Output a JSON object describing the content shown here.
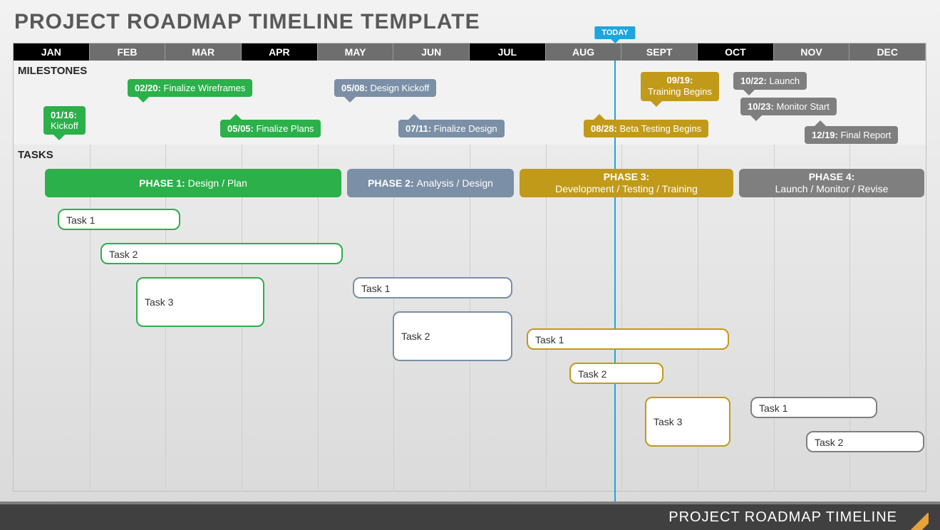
{
  "title": "PROJECT ROADMAP TIMELINE TEMPLATE",
  "footer": "PROJECT ROADMAP TIMELINE",
  "today_label": "TODAY",
  "months": [
    "JAN",
    "FEB",
    "MAR",
    "APR",
    "MAY",
    "JUN",
    "JUL",
    "AUG",
    "SEPT",
    "OCT",
    "NOV",
    "DEC"
  ],
  "section_labels": {
    "milestones": "MILESTONES",
    "tasks": "TASKS"
  },
  "milestones": [
    {
      "date": "01/16:",
      "text": "Kickoff"
    },
    {
      "date": "02/20:",
      "text": "Finalize Wireframes"
    },
    {
      "date": "05/05:",
      "text": "Finalize Plans"
    },
    {
      "date": "05/08:",
      "text": "Design Kickoff"
    },
    {
      "date": "07/11:",
      "text": "Finalize Design"
    },
    {
      "date": "08/28:",
      "text": "Beta Testing Begins"
    },
    {
      "date": "09/19:",
      "text": "Training Begins"
    },
    {
      "date": "10/22:",
      "text": "Launch"
    },
    {
      "date": "10/23:",
      "text": "Monitor Start"
    },
    {
      "date": "12/19:",
      "text": "Final Report"
    }
  ],
  "phases": [
    {
      "title": "PHASE 1:",
      "sub": "Design / Plan"
    },
    {
      "title": "PHASE 2:",
      "sub": "Analysis / Design"
    },
    {
      "title": "PHASE 3:",
      "sub": "Development / Testing / Training"
    },
    {
      "title": "PHASE 4:",
      "sub": "Launch / Monitor / Revise"
    }
  ],
  "tasks": {
    "p1": [
      "Task 1",
      "Task 2",
      "Task 3"
    ],
    "p2": [
      "Task 1",
      "Task 2"
    ],
    "p3": [
      "Task 1",
      "Task 2",
      "Task 3"
    ],
    "p4": [
      "Task 1",
      "Task 2"
    ]
  },
  "chart_data": {
    "type": "gantt",
    "today_month_fraction": 7.9,
    "phases": [
      {
        "name": "PHASE 1: Design / Plan",
        "start_month": 0.4,
        "end_month": 4.3,
        "color": "#2bb04a"
      },
      {
        "name": "PHASE 2: Analysis / Design",
        "start_month": 4.4,
        "end_month": 6.6,
        "color": "#7b8fa6"
      },
      {
        "name": "PHASE 3: Development / Testing / Training",
        "start_month": 6.7,
        "end_month": 9.5,
        "color": "#c19a1a"
      },
      {
        "name": "PHASE 4: Launch / Monitor / Revise",
        "start_month": 9.6,
        "end_month": 12.0,
        "color": "#7f7f7f"
      }
    ],
    "milestones": [
      {
        "date": "01/16",
        "label": "Kickoff",
        "phase": 1
      },
      {
        "date": "02/20",
        "label": "Finalize Wireframes",
        "phase": 1
      },
      {
        "date": "05/05",
        "label": "Finalize Plans",
        "phase": 1
      },
      {
        "date": "05/08",
        "label": "Design Kickoff",
        "phase": 2
      },
      {
        "date": "07/11",
        "label": "Finalize Design",
        "phase": 2
      },
      {
        "date": "08/28",
        "label": "Beta Testing Begins",
        "phase": 3
      },
      {
        "date": "09/19",
        "label": "Training Begins",
        "phase": 3
      },
      {
        "date": "10/22",
        "label": "Launch",
        "phase": 4
      },
      {
        "date": "10/23",
        "label": "Monitor Start",
        "phase": 4
      },
      {
        "date": "12/19",
        "label": "Final Report",
        "phase": 4
      }
    ],
    "tasks": [
      {
        "phase": 1,
        "name": "Task 1",
        "start_month": 0.6,
        "end_month": 2.2
      },
      {
        "phase": 1,
        "name": "Task 2",
        "start_month": 1.15,
        "end_month": 4.35
      },
      {
        "phase": 1,
        "name": "Task 3",
        "start_month": 1.6,
        "end_month": 3.3
      },
      {
        "phase": 2,
        "name": "Task 1",
        "start_month": 4.45,
        "end_month": 6.55
      },
      {
        "phase": 2,
        "name": "Task 2",
        "start_month": 5.0,
        "end_month": 6.55
      },
      {
        "phase": 3,
        "name": "Task 1",
        "start_month": 6.75,
        "end_month": 9.4
      },
      {
        "phase": 3,
        "name": "Task 2",
        "start_month": 7.3,
        "end_month": 8.55
      },
      {
        "phase": 3,
        "name": "Task 3",
        "start_month": 8.3,
        "end_month": 9.4
      },
      {
        "phase": 4,
        "name": "Task 1",
        "start_month": 9.7,
        "end_month": 11.35
      },
      {
        "phase": 4,
        "name": "Task 2",
        "start_month": 10.4,
        "end_month": 12.0
      }
    ]
  }
}
